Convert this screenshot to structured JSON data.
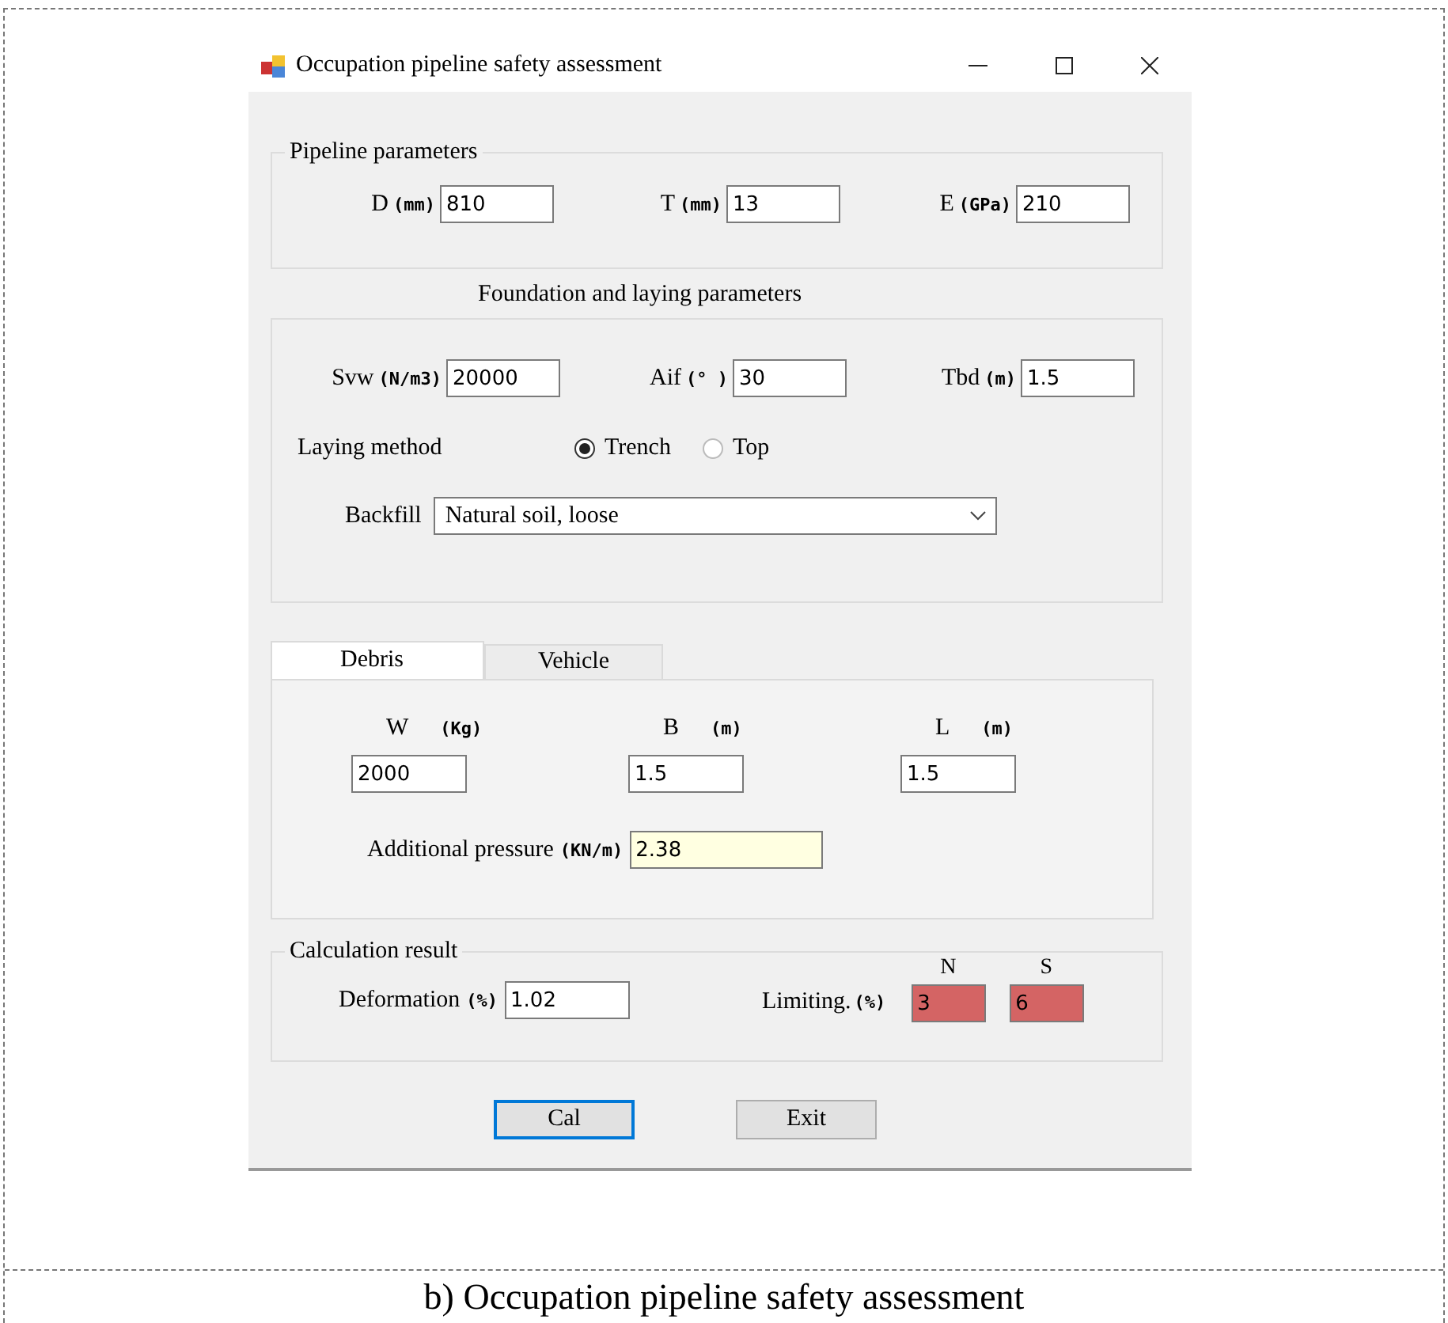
{
  "window": {
    "title": "Occupation pipeline safety assessment"
  },
  "pipeline_parameters": {
    "title": "Pipeline parameters",
    "fields": [
      {
        "label": "D",
        "unit": "(mm)",
        "value": "810"
      },
      {
        "label": "T",
        "unit": "(mm)",
        "value": "13"
      },
      {
        "label": "E",
        "unit": "(GPa)",
        "value": "210"
      }
    ]
  },
  "foundation": {
    "title": "Foundation and laying parameters",
    "fields": [
      {
        "label": "Svw",
        "unit": "(N/m3)",
        "value": "20000"
      },
      {
        "label": "Aif",
        "unit": "(° )",
        "value": "30"
      },
      {
        "label": "Tbd",
        "unit": "(m)",
        "value": "1.5"
      }
    ],
    "laying_method": {
      "label": "Laying method",
      "options": [
        {
          "label": "Trench",
          "selected": true
        },
        {
          "label": "Top",
          "selected": false
        }
      ]
    },
    "backfill": {
      "label": "Backfill",
      "value": "Natural soil, loose"
    }
  },
  "tabs": [
    {
      "label": "Debris",
      "selected": true
    },
    {
      "label": "Vehicle",
      "selected": false
    }
  ],
  "debris": {
    "fields": [
      {
        "label": "W",
        "unit": "(Kg)",
        "value": "2000"
      },
      {
        "label": "B",
        "unit": "(m)",
        "value": "1.5"
      },
      {
        "label": "L",
        "unit": "(m)",
        "value": "1.5"
      }
    ],
    "additional_pressure": {
      "label": "Additional pressure",
      "unit": "(KN/m)",
      "value": "2.38"
    }
  },
  "result": {
    "title": "Calculation result",
    "deformation": {
      "label": "Deformation",
      "unit": "(%)",
      "value": "1.02"
    },
    "limiting": {
      "label": "Limiting.",
      "unit": "(%)",
      "columns": [
        {
          "header": "N",
          "value": "3"
        },
        {
          "header": "S",
          "value": "6"
        }
      ]
    }
  },
  "buttons": [
    {
      "label": "Cal",
      "focused": true
    },
    {
      "label": "Exit",
      "focused": false
    }
  ],
  "caption": "b) Occupation pipeline safety assessment"
}
